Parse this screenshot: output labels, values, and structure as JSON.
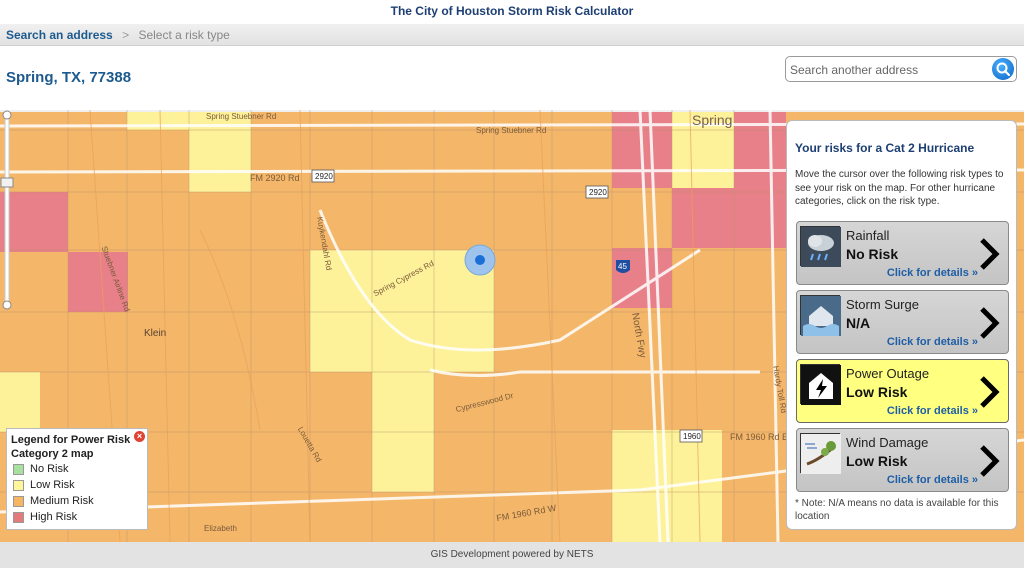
{
  "app": {
    "title": "The City of Houston Storm Risk Calculator"
  },
  "breadcrumb": {
    "step1": "Search an address",
    "separator": ">",
    "step2": "Select a risk type"
  },
  "location": "Spring, TX, 77388",
  "search": {
    "placeholder": "Search another address",
    "icon": "search-icon"
  },
  "map": {
    "labels": {
      "fm2920": "FM 2920 Rd",
      "spring_stuebner": "Spring Stuebner Rd",
      "spring_cypress": "Spring Cypress Rd",
      "cypresswood": "Cypresswood Dr",
      "north_fwy": "North Fwy",
      "fm1960": "FM 1960 Rd E",
      "klein": "Klein",
      "spring": "Spring",
      "stuebner_airline": "Stuebner Airline Rd",
      "kuykendahl": "Kuykendahl Rd",
      "hardy": "Hardy Toll Rd",
      "louetta": "Louetta Rd",
      "shield_2920a": "2920",
      "shield_2920b": "2920",
      "shield_1960": "1960",
      "shield_45": "45",
      "fm1960w": "FM 1960 Rd W",
      "elizabeth": "Elizabeth"
    }
  },
  "legend": {
    "title": "Legend for Power Risk",
    "subtitle": "Category 2 map",
    "items": [
      {
        "label": "No Risk",
        "color": "#a8e0a0"
      },
      {
        "label": "Low Risk",
        "color": "#fff59a"
      },
      {
        "label": "Medium Risk",
        "color": "#f5b562"
      },
      {
        "label": "High Risk",
        "color": "#e57a7a"
      }
    ]
  },
  "panel": {
    "title": "Your risks for a Cat 2 Hurricane",
    "intro": "Move the cursor over the following risk types to see your risk on the map. For other hurricane categories, click on the risk type.",
    "cards": [
      {
        "name": "Rainfall",
        "level": "No Risk",
        "details": "Click for details »",
        "icon": "rain-cloud-icon"
      },
      {
        "name": "Storm Surge",
        "level": "N/A",
        "details": "Click for details »",
        "icon": "flooded-house-icon"
      },
      {
        "name": "Power Outage",
        "level": "Low Risk",
        "details": "Click for details »",
        "icon": "lightning-icon"
      },
      {
        "name": "Wind Damage",
        "level": "Low Risk",
        "details": "Click for details »",
        "icon": "wind-tree-icon"
      }
    ],
    "note": "* Note: N/A means no data is available for this location"
  },
  "footer": "GIS Development powered by NETS"
}
